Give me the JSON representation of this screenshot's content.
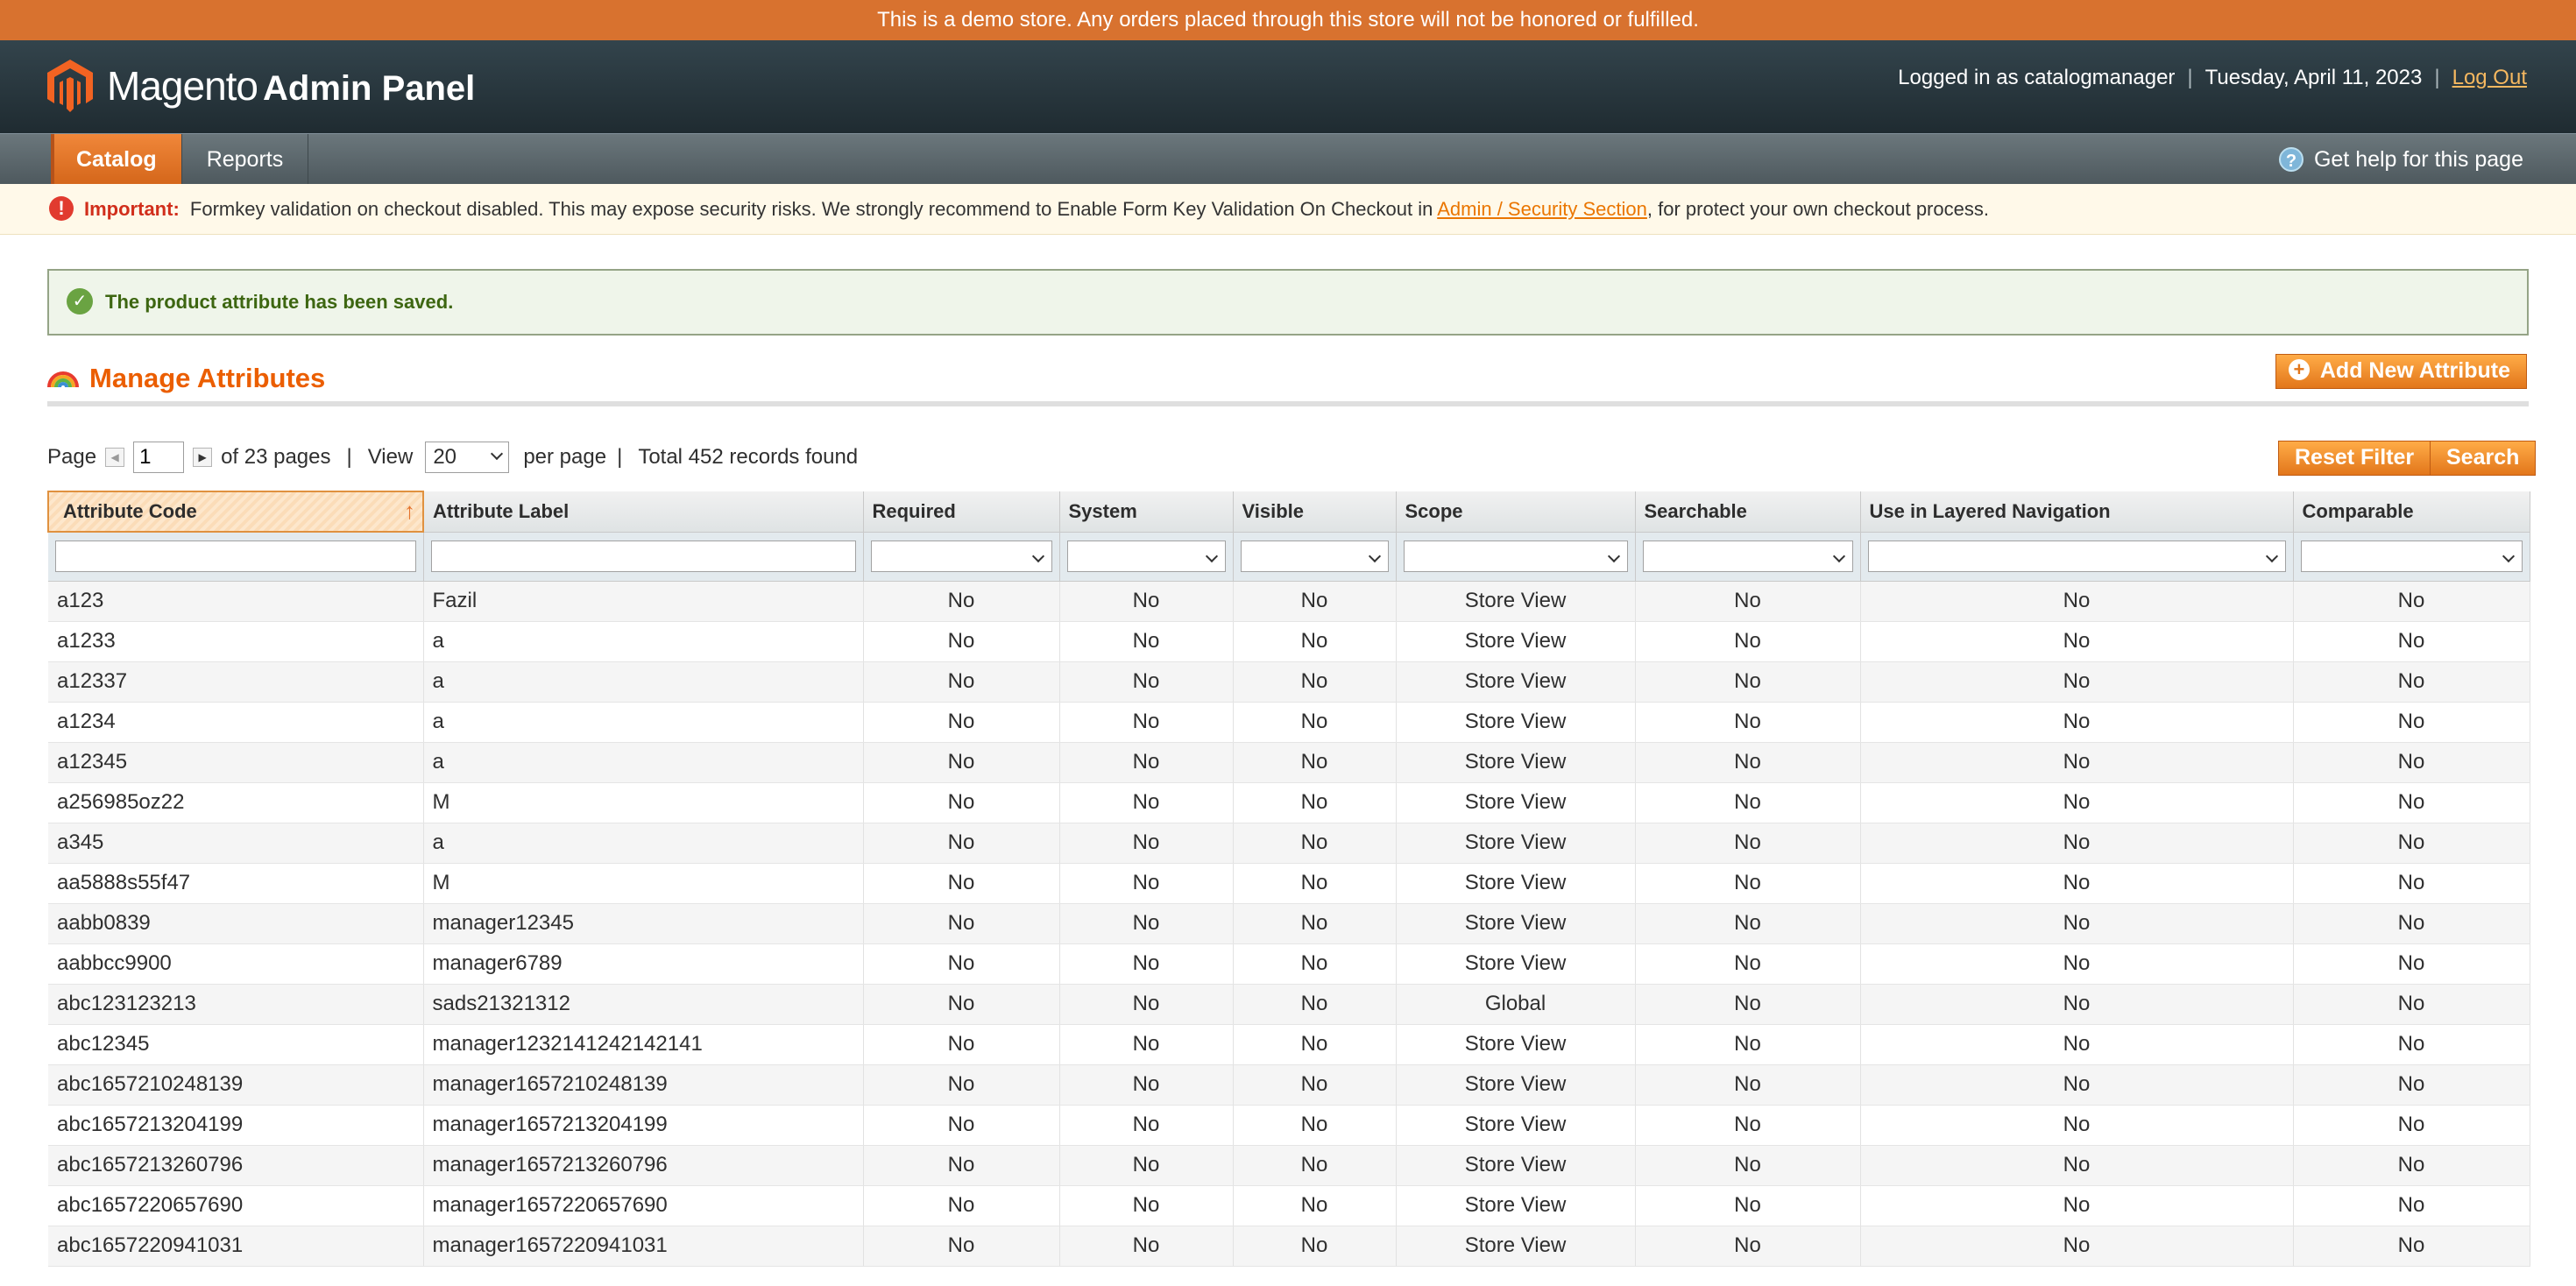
{
  "demo_notice": "This is a demo store. Any orders placed through this store will not be honored or fulfilled.",
  "header": {
    "logo_main": "Magento",
    "logo_sub": "Admin Panel",
    "logged_in": "Logged in as catalogmanager",
    "date": "Tuesday, April 11, 2023",
    "logout": "Log Out"
  },
  "nav": {
    "items": [
      {
        "label": "Catalog",
        "active": true
      },
      {
        "label": "Reports",
        "active": false
      }
    ],
    "help": "Get help for this page"
  },
  "message": {
    "important": "Important:",
    "text_before": "Formkey validation on checkout disabled. This may expose security risks. We strongly recommend to Enable Form Key Validation On Checkout in",
    "link": "Admin / Security Section",
    "text_after": ", for protect your own checkout process."
  },
  "success": "The product attribute has been saved.",
  "page": {
    "title": "Manage Attributes",
    "add_button": "Add New Attribute"
  },
  "pager": {
    "page_label": "Page",
    "page_value": "1",
    "of_pages": "of 23 pages",
    "view_label": "View",
    "per_page_value": "20",
    "per_page_label": "per page",
    "total": "Total 452 records found",
    "reset_filter": "Reset Filter",
    "search": "Search"
  },
  "grid": {
    "columns": [
      "Attribute Code",
      "Attribute Label",
      "Required",
      "System",
      "Visible",
      "Scope",
      "Searchable",
      "Use in Layered Navigation",
      "Comparable"
    ],
    "rows": [
      [
        "a123",
        "Fazil",
        "No",
        "No",
        "No",
        "Store View",
        "No",
        "No",
        "No"
      ],
      [
        "a1233",
        "a",
        "No",
        "No",
        "No",
        "Store View",
        "No",
        "No",
        "No"
      ],
      [
        "a12337",
        "a",
        "No",
        "No",
        "No",
        "Store View",
        "No",
        "No",
        "No"
      ],
      [
        "a1234",
        "a",
        "No",
        "No",
        "No",
        "Store View",
        "No",
        "No",
        "No"
      ],
      [
        "a12345",
        "a",
        "No",
        "No",
        "No",
        "Store View",
        "No",
        "No",
        "No"
      ],
      [
        "a256985oz22",
        "M",
        "No",
        "No",
        "No",
        "Store View",
        "No",
        "No",
        "No"
      ],
      [
        "a345",
        "a",
        "No",
        "No",
        "No",
        "Store View",
        "No",
        "No",
        "No"
      ],
      [
        "aa5888s55f47",
        "M",
        "No",
        "No",
        "No",
        "Store View",
        "No",
        "No",
        "No"
      ],
      [
        "aabb0839",
        "manager12345",
        "No",
        "No",
        "No",
        "Store View",
        "No",
        "No",
        "No"
      ],
      [
        "aabbcc9900",
        "manager6789",
        "No",
        "No",
        "No",
        "Store View",
        "No",
        "No",
        "No"
      ],
      [
        "abc123123213",
        "sads21321312",
        "No",
        "No",
        "No",
        "Global",
        "No",
        "No",
        "No"
      ],
      [
        "abc12345",
        "manager1232141242142141",
        "No",
        "No",
        "No",
        "Store View",
        "No",
        "No",
        "No"
      ],
      [
        "abc1657210248139",
        "manager1657210248139",
        "No",
        "No",
        "No",
        "Store View",
        "No",
        "No",
        "No"
      ],
      [
        "abc1657213204199",
        "manager1657213204199",
        "No",
        "No",
        "No",
        "Store View",
        "No",
        "No",
        "No"
      ],
      [
        "abc1657213260796",
        "manager1657213260796",
        "No",
        "No",
        "No",
        "Store View",
        "No",
        "No",
        "No"
      ],
      [
        "abc1657220657690",
        "manager1657220657690",
        "No",
        "No",
        "No",
        "Store View",
        "No",
        "No",
        "No"
      ],
      [
        "abc1657220941031",
        "manager1657220941031",
        "No",
        "No",
        "No",
        "Store View",
        "No",
        "No",
        "No"
      ]
    ]
  }
}
